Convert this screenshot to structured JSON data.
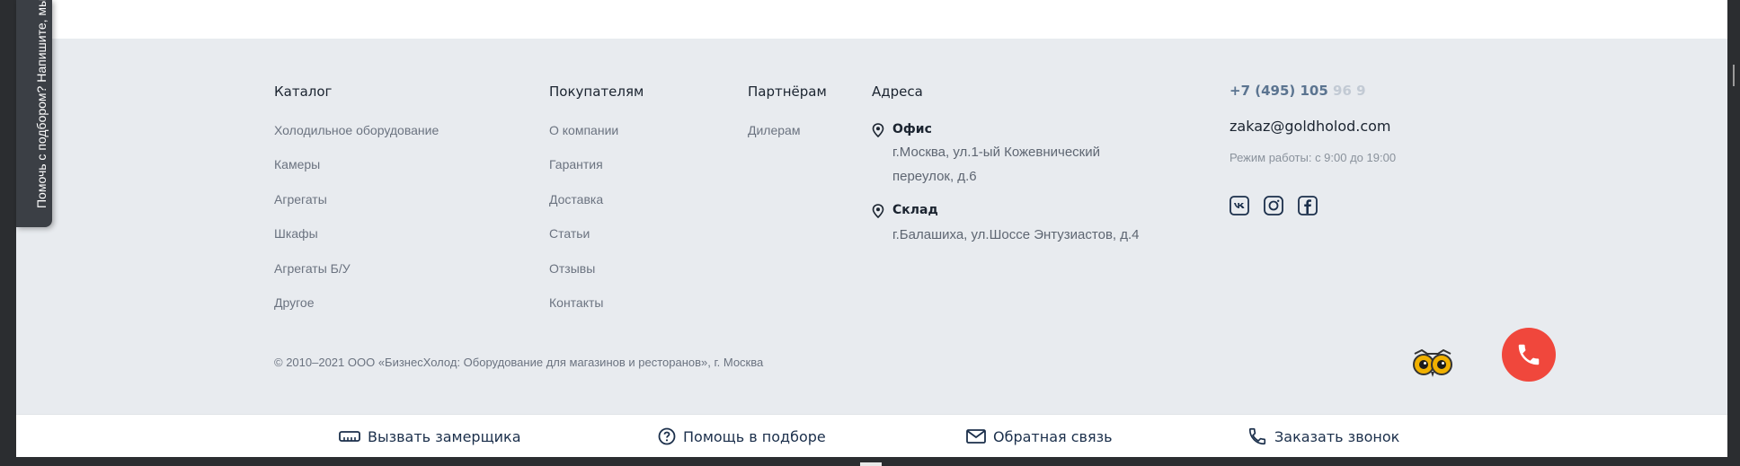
{
  "side_tab": {
    "label": "Помочь с подбором? Напишите, мы"
  },
  "catalog": {
    "title": "Каталог",
    "items": [
      "Холодильное оборудование",
      "Камеры",
      "Агрегаты",
      "Шкафы",
      "Агрегаты Б/У",
      "Другое"
    ]
  },
  "buyers": {
    "title": "Покупателям",
    "items": [
      "О компании",
      "Гарантия",
      "Доставка",
      "Статьи",
      "Отзывы",
      "Контакты"
    ]
  },
  "partners": {
    "title": "Партнёрам",
    "items": [
      "Дилерам"
    ]
  },
  "addresses": {
    "title": "Адреса",
    "office_label": "Офис",
    "office_line1": "г.Москва, ул.1-ый Кожевнический",
    "office_line2": "переулок, д.6",
    "warehouse_label": "Склад",
    "warehouse_text": "г.Балашиха, ул.Шоссе Энтузиастов, д.4"
  },
  "contacts": {
    "phone_visible": "+7 (495) 105",
    "phone_faded": "96 9",
    "email": "zakaz@goldholod.com",
    "hours": "Режим работы: с 9:00 до 19:00",
    "social_icons": [
      "vk-icon",
      "instagram-icon",
      "facebook-icon"
    ]
  },
  "copyright": "© 2010–2021 ООО «БизнесХолод: Оборудование для магазинов и ресторанов», г. Москва",
  "actions": {
    "measurer": "Вызвать замерщика",
    "help": "Помощь в подборе",
    "feedback": "Обратная связь",
    "callback": "Заказать звонок"
  },
  "colors": {
    "footer_bg": "#e8ebef",
    "text_dark": "#1b2430",
    "link_gray": "#6b7380",
    "call_red": "#f0473c",
    "action_blue": "#1b2f4b"
  }
}
